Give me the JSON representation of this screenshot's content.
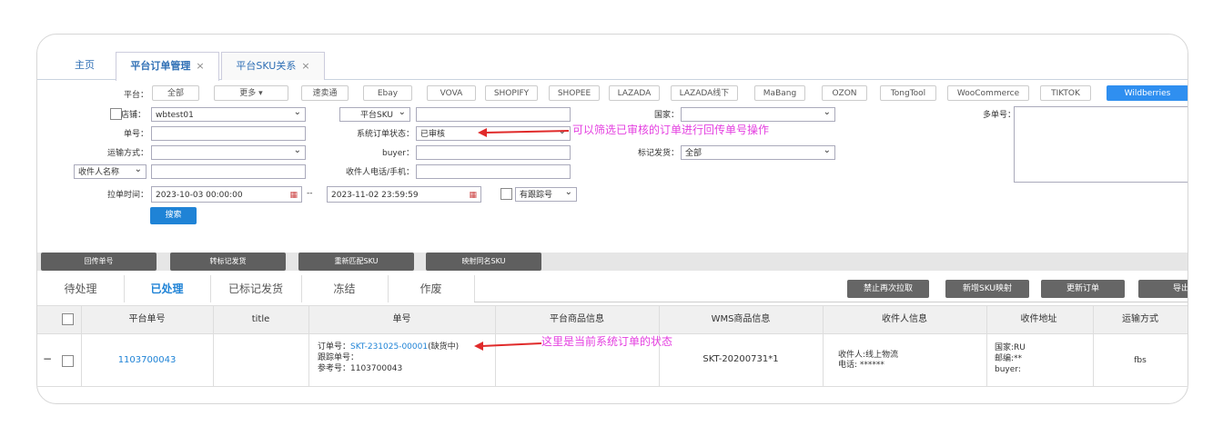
{
  "tabs": [
    {
      "label": "主页",
      "close": ""
    },
    {
      "label": "平台订单管理",
      "close": "×"
    },
    {
      "label": "平台SKU关系",
      "close": "×"
    }
  ],
  "filters": {
    "platform_label": "平台：",
    "platforms": [
      "全部",
      "更多 ▾",
      "速卖通",
      "Ebay",
      "VOVA",
      "SHOPIFY",
      "SHOPEE",
      "LAZADA",
      "LAZADA线下",
      "MaBang",
      "OZON",
      "TongTool",
      "WooCommerce",
      "TIKTOK",
      "Wildberries"
    ],
    "store_label": "店铺：",
    "store_value": "wbtest01",
    "platform_sku_label": "平台SKU",
    "platform_sku_value": "",
    "country_label": "国家：",
    "country_value": "",
    "multi_order_label": "多单号：",
    "order_no_label": "单号：",
    "sys_status_label": "系统订单状态：",
    "sys_status_value": "已审核",
    "shipping_label": "运输方式：",
    "buyer_label": "buyer：",
    "mark_ship_label": "标记发货：",
    "mark_ship_value": "全部",
    "recipient_name_label": "收件人名称",
    "recipient_phone_label": "收件人电话/手机：",
    "pull_time_label": "拉单时间：",
    "time_start": "2023-10-03 00:00:00",
    "time_sep": "--",
    "time_end": "2023-11-02 23:59:59",
    "tracking_label": "有跟踪号",
    "search_button": "搜索"
  },
  "notes": {
    "note1": "可以筛选已审核的订单进行回传单号操作",
    "note2": "这里是当前系统订单的状态"
  },
  "actions": [
    "回传单号",
    "转标记发货",
    "重新匹配SKU",
    "映射同名SKU"
  ],
  "status_tabs": [
    "待处理",
    "已处理",
    "已标记发货",
    "冻结",
    "作废"
  ],
  "right_actions": [
    "禁止再次拉取",
    "新增SKU映射",
    "更新订单",
    "导出"
  ],
  "table": {
    "headers": [
      "平台单号",
      "title",
      "单号",
      "平台商品信息",
      "WMS商品信息",
      "收件人信息",
      "收件地址",
      "运输方式"
    ],
    "row": {
      "toggle": "−",
      "platform_no": "1103700043",
      "order_prefix": "订单号：",
      "order_no": "SKT-231025-00001",
      "order_status": "(缺货中)",
      "tracking": "跟踪单号：",
      "ref": "参考号：1103700043",
      "wms": "SKT-20200731*1",
      "recipient": "收件人:线上物流",
      "phone": "电话: ******",
      "addr_country": "国家:RU",
      "addr_zip": "邮编:**",
      "addr_buyer": "buyer:",
      "shipping": "fbs"
    }
  },
  "colors": {
    "accent": "#1f83d6",
    "note": "#e43fe0",
    "arrow": "#e02a2a"
  }
}
